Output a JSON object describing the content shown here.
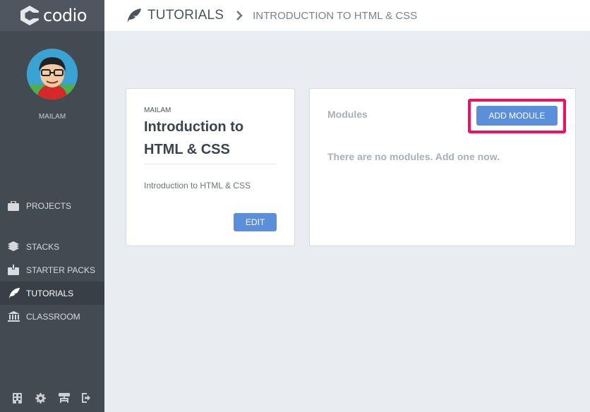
{
  "app": {
    "logo_text": "codio"
  },
  "user": {
    "name": "MAILAM"
  },
  "sidebar": {
    "items": [
      {
        "label": "PROJECTS",
        "icon": "briefcase-icon",
        "active": false
      },
      {
        "label": "STACKS",
        "icon": "layers-icon",
        "active": false
      },
      {
        "label": "STARTER PACKS",
        "icon": "box-icon",
        "active": false
      },
      {
        "label": "TUTORIALS",
        "icon": "feather-icon",
        "active": true
      },
      {
        "label": "CLASSROOM",
        "icon": "institution-icon",
        "active": false
      }
    ],
    "bottom_icons": [
      "building-icon",
      "gear-icon",
      "sitemap-icon",
      "logout-icon"
    ]
  },
  "header": {
    "breadcrumb_root": "TUTORIALS",
    "breadcrumb_current": "INTRODUCTION TO HTML & CSS"
  },
  "tutorial_card": {
    "owner": "MAILAM",
    "title": "Introduction to HTML & CSS",
    "description": "Introduction to HTML & CSS",
    "edit_label": "EDIT"
  },
  "modules_card": {
    "label": "Modules",
    "add_label": "ADD MODULE",
    "empty_message": "There are no modules. Add one now."
  },
  "colors": {
    "sidebar_bg": "#424a52",
    "accent_button": "#5b8fd9",
    "highlight_border": "#f0105f"
  }
}
